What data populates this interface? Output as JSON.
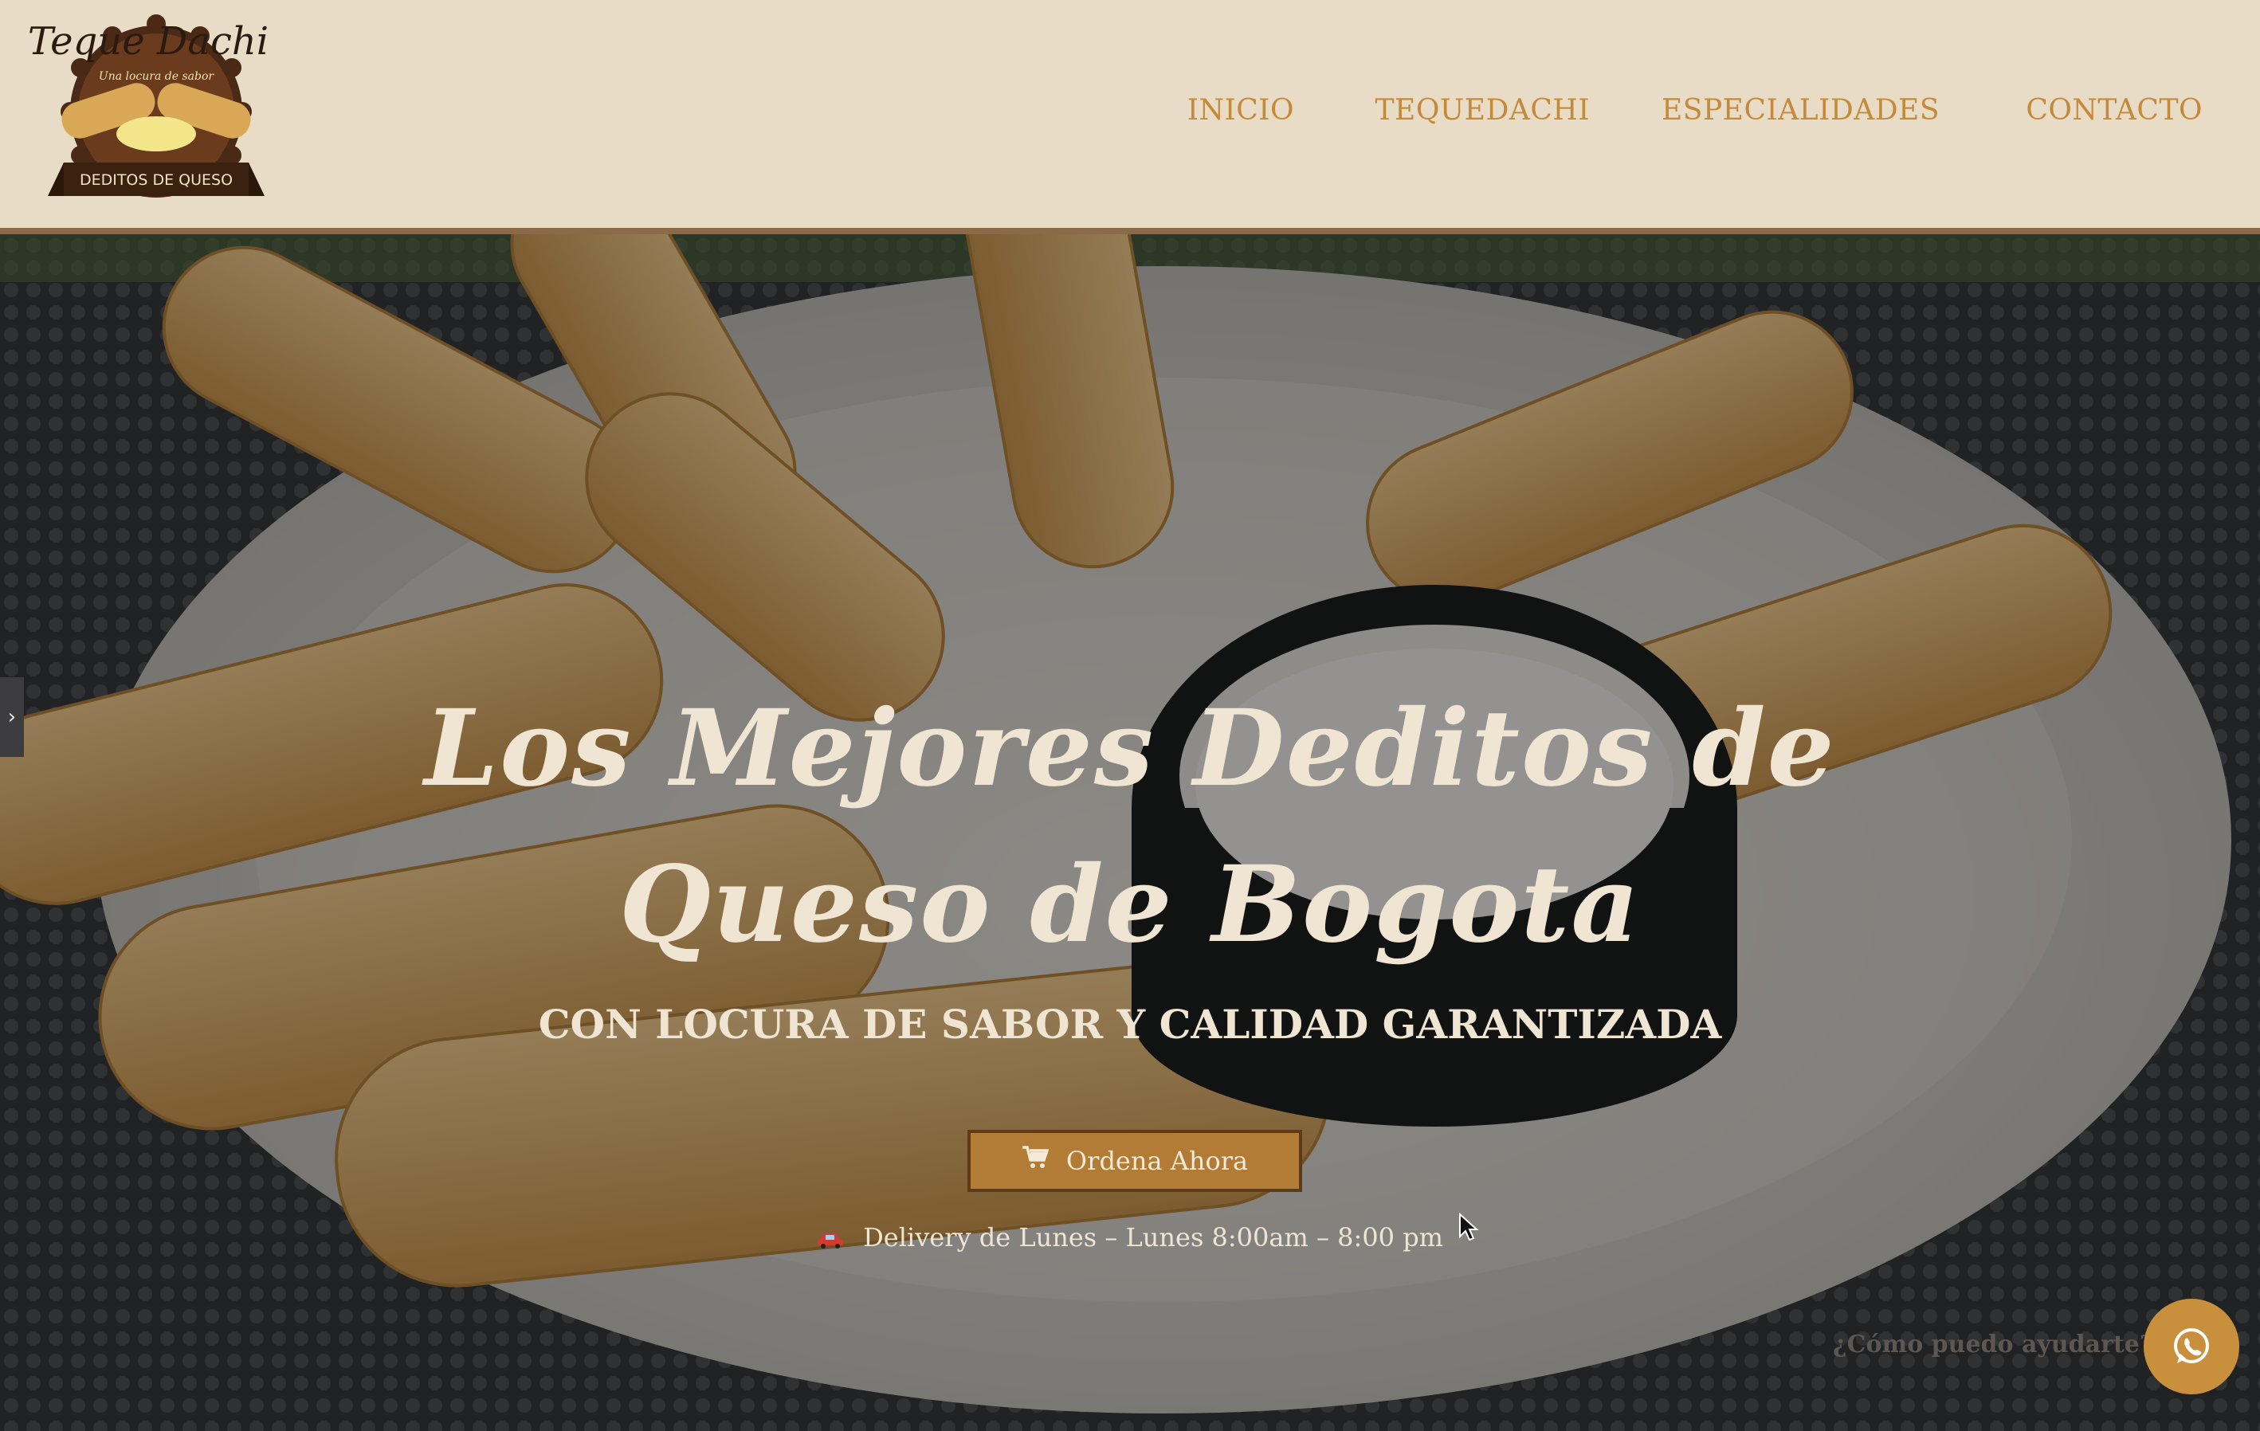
{
  "logo": {
    "brand": "Teque Dachi",
    "tagline": "Una locura de sabor",
    "ribbon": "DEDITOS DE QUESO"
  },
  "nav": {
    "items": [
      "INICIO",
      "TEQUEDACHI",
      "ESPECIALIDADES",
      "CONTACTO"
    ]
  },
  "hero": {
    "title": "Los Mejores Deditos de Queso de Bogota",
    "subtitle": "CON LOCURA DE SABOR Y CALIDAD GARANTIZADA",
    "order_button": "Ordena Ahora",
    "delivery": "Delivery de Lunes – Lunes 8:00am – 8:00 pm"
  },
  "chat": {
    "prompt": "¿Cómo puedo ayudarte?"
  },
  "icons": {
    "cart": "cart-icon",
    "car": "car-icon",
    "whatsapp": "whatsapp-icon",
    "side_tab": "chevron-right-icon"
  },
  "colors": {
    "header_bg": "#e8dcc6",
    "nav_text": "#c5893a",
    "button_bg": "#b27b36",
    "hero_text": "#efe5d2",
    "whatsapp_bg": "#c8903c"
  }
}
